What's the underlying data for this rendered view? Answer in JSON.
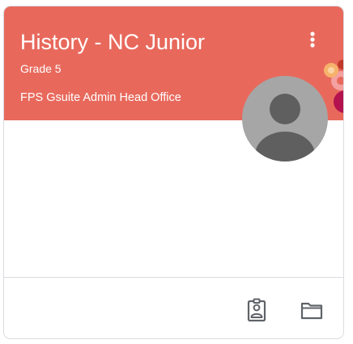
{
  "card": {
    "title": "History - NC Junior",
    "section": "Grade 5",
    "owner": "FPS Gsuite Admin Head Office"
  },
  "colors": {
    "header": "#e8695c",
    "text_on_header": "#ffffff",
    "avatar_bg": "#a6a6a6",
    "avatar_figure": "#5f5f5f",
    "icon": "#5f6368",
    "divider": "#dadce0"
  },
  "icons": {
    "more": "more-vert-icon",
    "avatar": "person-icon",
    "work": "assignment-ind-icon",
    "folder": "folder-icon"
  }
}
